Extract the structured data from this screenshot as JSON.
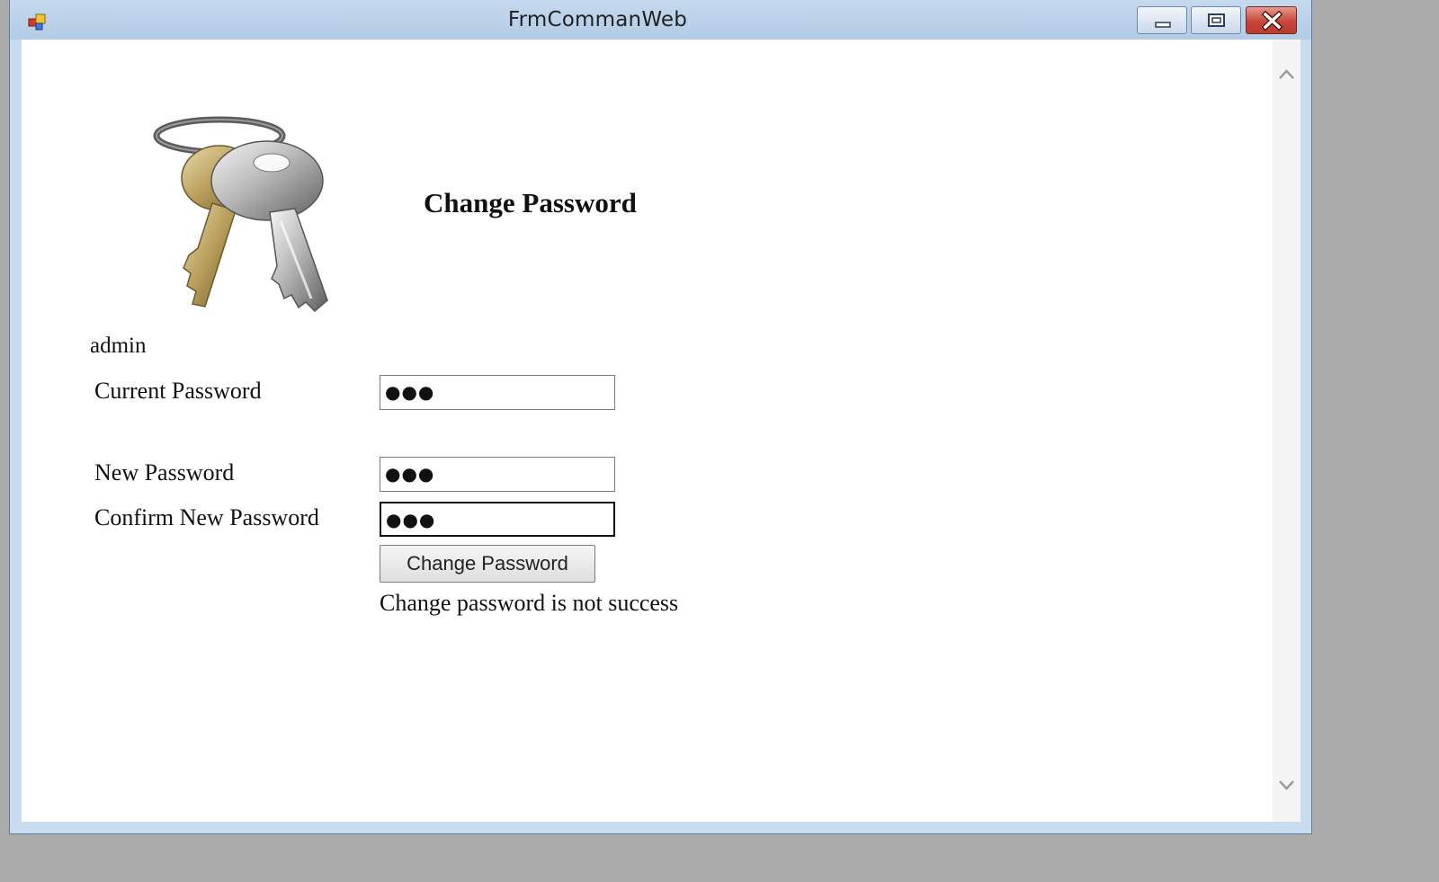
{
  "window": {
    "title": "FrmCommanWeb"
  },
  "form": {
    "heading": "Change Password",
    "username": "admin",
    "fields": [
      {
        "label": "Current Password",
        "masked_value": "●●●"
      },
      {
        "label": "New Password",
        "masked_value": "●●●"
      },
      {
        "label": "Confirm New Password",
        "masked_value": "●●●"
      }
    ],
    "submit_label": "Change Password",
    "status_message": "Change password is not success"
  },
  "icons": {
    "app": "app-icon",
    "minimize": "minimize-icon",
    "maximize": "restore-icon",
    "close": "close-icon",
    "illustration": "keys-icon",
    "scroll_up": "chevron-up-icon",
    "scroll_down": "chevron-down-icon"
  },
  "colors": {
    "titlebar": "#b3cbe6",
    "close_button": "#c8453a",
    "client_bg": "#ffffff"
  }
}
